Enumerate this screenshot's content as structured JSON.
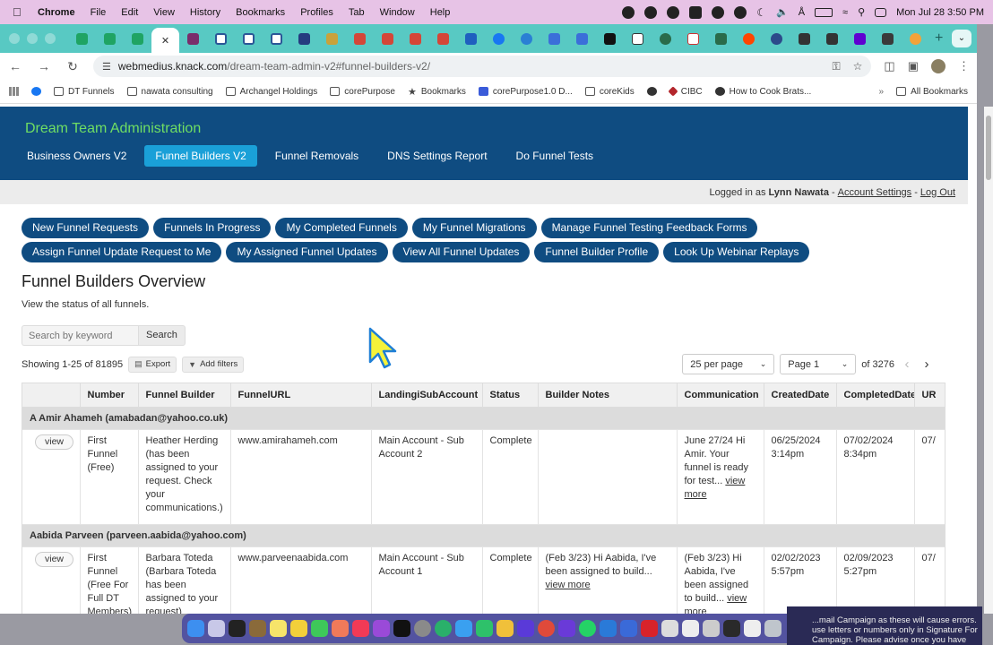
{
  "menubar": {
    "app": "Chrome",
    "items": [
      "File",
      "Edit",
      "View",
      "History",
      "Bookmarks",
      "Profiles",
      "Tab",
      "Window",
      "Help"
    ],
    "clock": "Mon Jul 28  3:50 PM"
  },
  "browser": {
    "url_host": "webmedius.knack.com",
    "url_path": "/dream-team-admin-v2#funnel-builders-v2/",
    "bookmarks": [
      {
        "label": "DT Funnels",
        "icon": "folder-icon"
      },
      {
        "label": "nawata consulting",
        "icon": "folder-icon"
      },
      {
        "label": "Archangel Holdings",
        "icon": "folder-icon"
      },
      {
        "label": "corePurpose",
        "icon": "folder-icon"
      },
      {
        "label": "Bookmarks",
        "icon": "star-icon"
      },
      {
        "label": "corePurpose1.0 D...",
        "icon": "app-icon"
      },
      {
        "label": "coreKids",
        "icon": "folder-icon"
      },
      {
        "label": "CIBC",
        "icon": "cibc-icon"
      },
      {
        "label": "How to Cook Brats...",
        "icon": "site-icon"
      }
    ],
    "all_bookmarks": "All Bookmarks"
  },
  "app": {
    "title": "Dream Team Administration",
    "nav": [
      {
        "label": "Business Owners V2",
        "active": false
      },
      {
        "label": "Funnel Builders V2",
        "active": true
      },
      {
        "label": "Funnel Removals",
        "active": false
      },
      {
        "label": "DNS Settings Report",
        "active": false
      },
      {
        "label": "Do Funnel Tests",
        "active": false
      }
    ],
    "userbar": {
      "prefix": "Logged in as",
      "user": "Lynn Nawata",
      "sep1": "-",
      "account": "Account Settings",
      "sep2": "-",
      "logout": "Log Out"
    }
  },
  "actions": {
    "row1": [
      "New Funnel Requests",
      "Funnels In Progress",
      "My Completed Funnels",
      "My Funnel Migrations",
      "Manage Funnel Testing Feedback Forms"
    ],
    "row2": [
      "Assign Funnel Update Request to Me",
      "My Assigned Funnel Updates",
      "View All Funnel Updates",
      "Funnel Builder Profile",
      "Look Up Webinar Replays"
    ]
  },
  "main": {
    "heading": "Funnel Builders Overview",
    "subheading": "View the status of all funnels.",
    "search": {
      "placeholder": "Search by keyword",
      "button": "Search"
    },
    "showing": "Showing 1-25 of 81895",
    "export": "Export",
    "add_filters": "Add filters",
    "per_page": "25 per page",
    "page": "Page 1",
    "of_pages": "of 3276"
  },
  "table": {
    "columns": [
      "",
      "Number",
      "Funnel Builder",
      "FunnelURL",
      "LandingiSubAccount",
      "Status",
      "Builder Notes",
      "Communication",
      "CreatedDate",
      "CompletedDate",
      "UR"
    ],
    "groups": [
      {
        "title": "A Amir Ahameh (amabadan@yahoo.co.uk)",
        "rows": [
          {
            "view": "view",
            "number": "First Funnel (Free)",
            "builder": "Heather Herding (has been assigned to your request. Check your communications.)",
            "url": "www.amirahameh.com",
            "subaccount": "Main Account - Sub Account 2",
            "status": "Complete",
            "notes": "",
            "notes_more": "",
            "communication": "June 27/24 Hi Amir. Your funnel is ready for test...",
            "comm_more": "view more",
            "created": "06/25/2024 3:14pm",
            "completed": "07/02/2024 8:34pm",
            "ur": "07/"
          }
        ]
      },
      {
        "title": "Aabida Parveen (parveen.aabida@yahoo.com)",
        "rows": [
          {
            "view": "view",
            "number": "First Funnel (Free For Full DT Members)",
            "builder": "Barbara Toteda (Barbara Toteda has been assigned to your request)",
            "url": "www.parveenaabida.com",
            "subaccount": "Main Account - Sub Account 1",
            "status": "Complete",
            "notes": "(Feb 3/23) Hi Aabida, I've been assigned to build...",
            "notes_more": "view more",
            "communication": "(Feb 3/23) Hi Aabida, I've been assigned to build...",
            "comm_more": "view more",
            "created": "02/02/2023 5:57pm",
            "completed": "02/09/2023 5:27pm",
            "ur": "07/"
          }
        ]
      }
    ]
  },
  "notification": {
    "lines": [
      "...mail Campaign as these will cause errors.",
      "use letters or numbers only in Signature For",
      "Campaign. Please advise once you have"
    ]
  },
  "colors": {
    "header": "#0f4c81",
    "title_green": "#6fde63",
    "active_nav": "#1aa0d8",
    "tabstrip": "#58c9c3",
    "menubar": "#e7c3e6",
    "cursor": "#f5f23a"
  }
}
